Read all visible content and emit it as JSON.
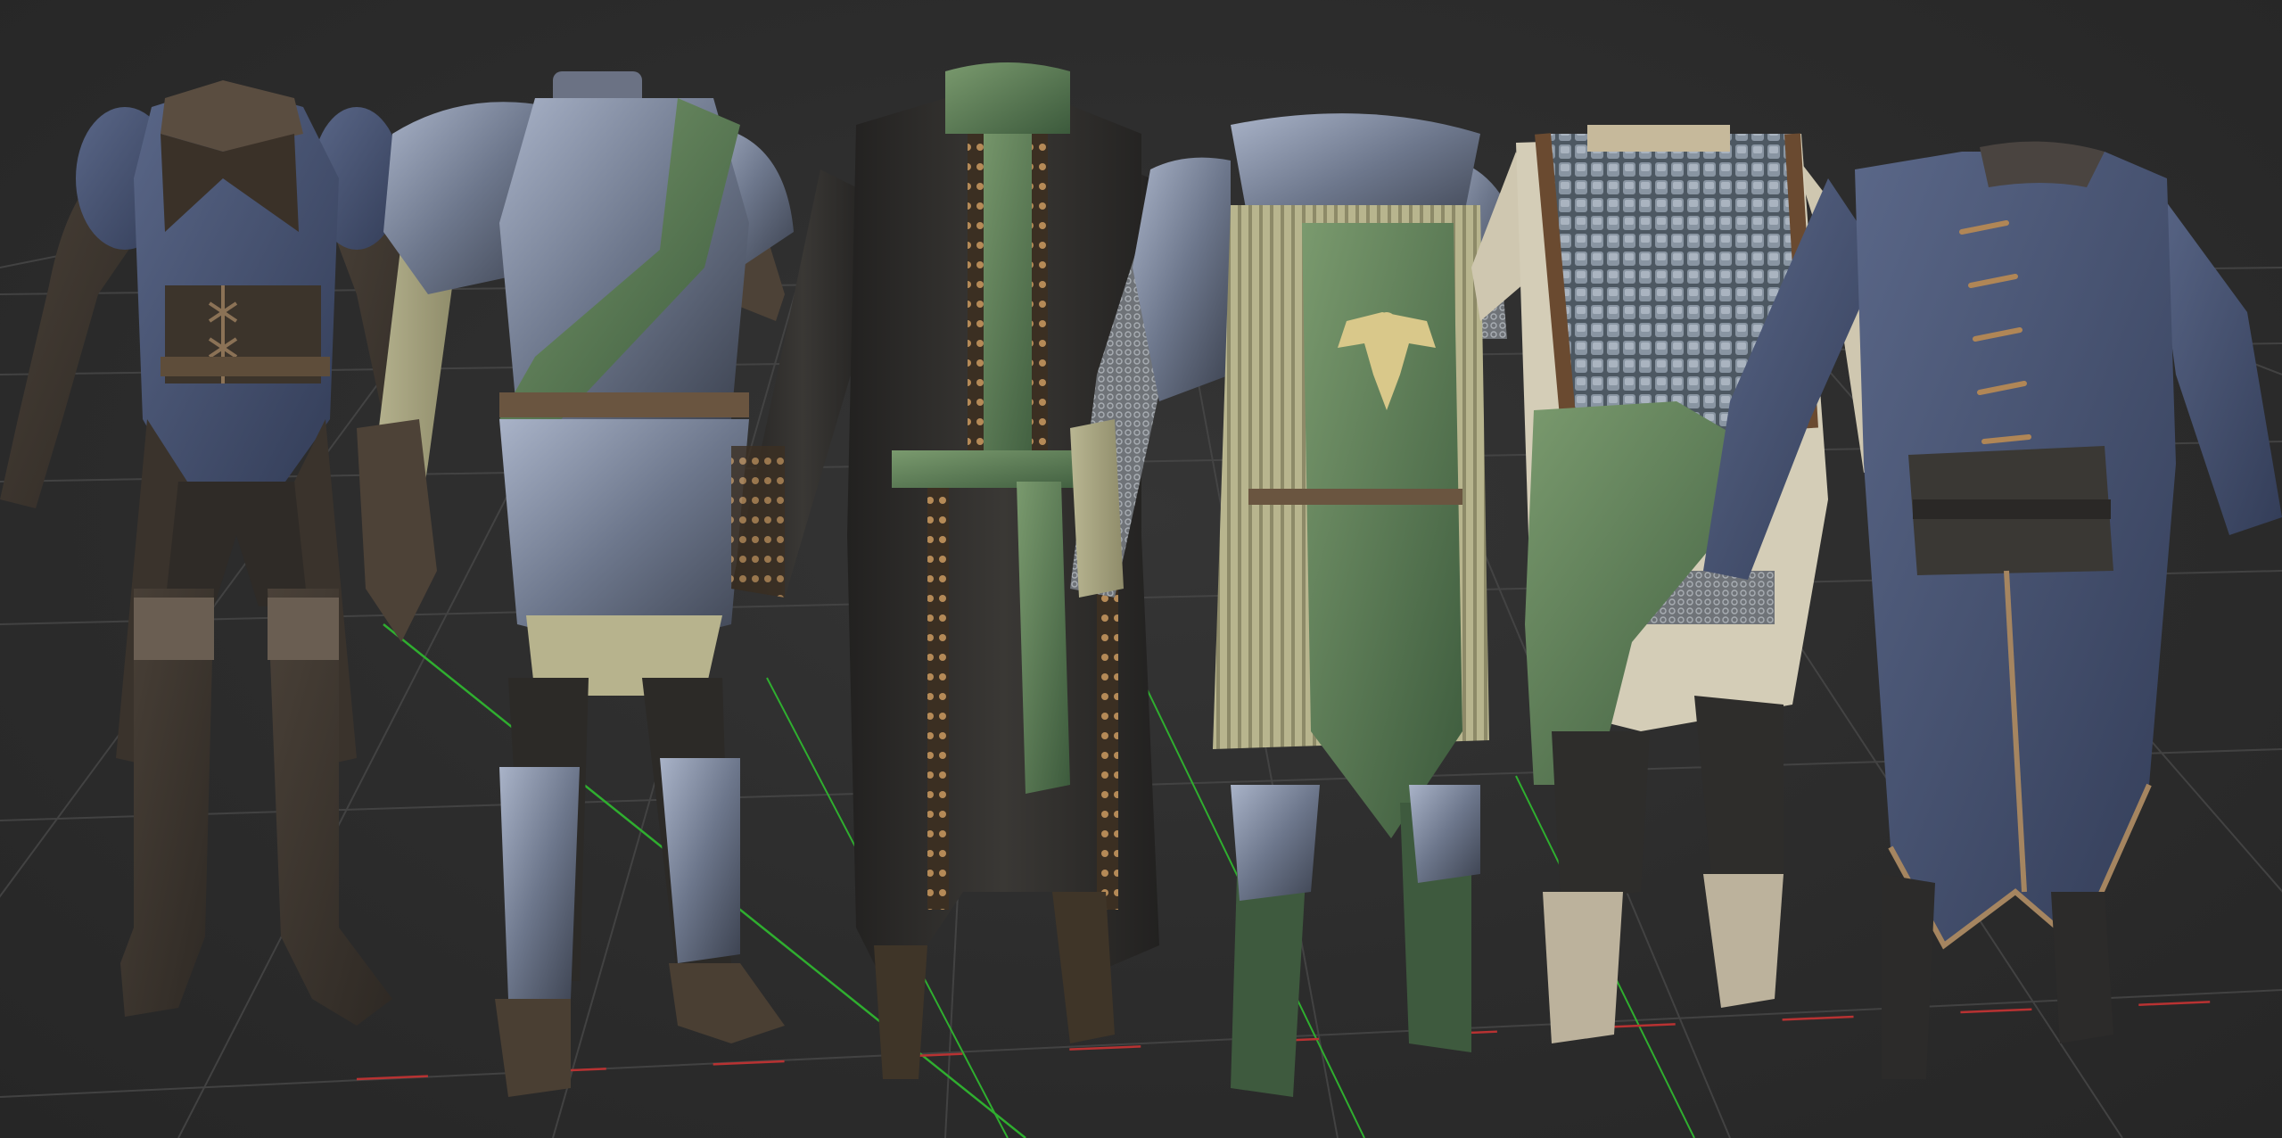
{
  "scene": {
    "kind": "3d-viewport",
    "background_color": "#2b2b2b",
    "grid": true,
    "grid_color": "#4a4a4a",
    "axis_colors": {
      "x": "#b83232",
      "z": "#2fae2f"
    },
    "outfits": [
      {
        "name": "leather-corset-outfit",
        "primary_color": "#4e5a78",
        "secondary_color": "#3a332c"
      },
      {
        "name": "plate-armor-with-green-sash",
        "primary_color": "#5c6678",
        "secondary_color": "#3f6a40"
      },
      {
        "name": "long-dark-robe",
        "primary_color": "#2f2e2c",
        "secondary_color": "#4b6d47"
      },
      {
        "name": "green-tabard-with-eagle",
        "primary_color": "#6e8a5e",
        "secondary_color": "#c6c7a4"
      },
      {
        "name": "scale-mail-with-scarf",
        "primary_color": "#5b6a73",
        "secondary_color": "#6f8f6a"
      },
      {
        "name": "blue-long-coat",
        "primary_color": "#3e4a6a",
        "secondary_color": "#2c2b2a"
      }
    ]
  }
}
